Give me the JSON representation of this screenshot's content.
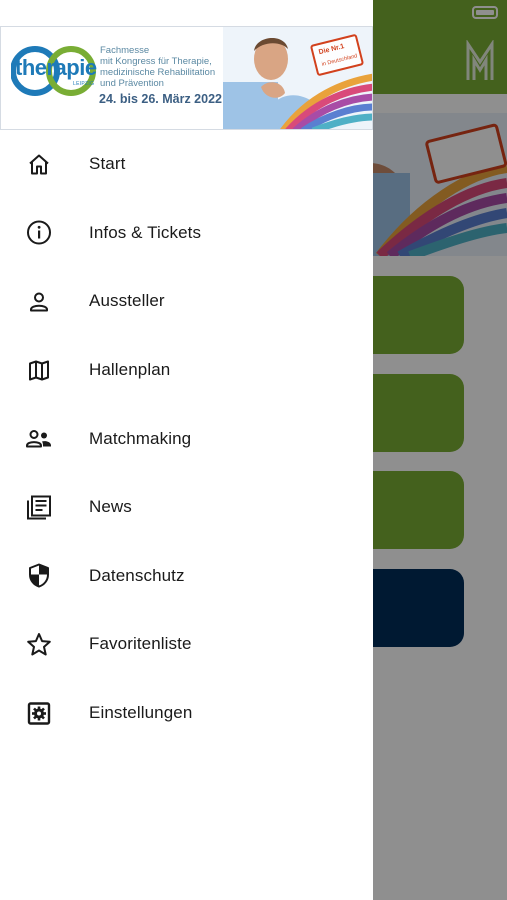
{
  "status_bar": {
    "battery_icon": "battery-full-icon"
  },
  "background_app": {
    "header_color": "#79ad35",
    "logo_icon": "messe-logo-icon",
    "tiles": [
      {
        "color": "#79ad35"
      },
      {
        "color": "#79ad35"
      },
      {
        "color": "#79ad35"
      },
      {
        "color": "#002d5a"
      }
    ]
  },
  "drawer": {
    "banner": {
      "brand": "therapie",
      "brand_sub": "LEIPZIG",
      "fair_lines": [
        "Fachmesse",
        "mit Kongress für Therapie,",
        "medizinische Rehabilitation",
        "und Prävention"
      ],
      "dates": "24. bis 26. März 2022",
      "badge_top": "Die Nr.1",
      "badge_sub": "in Deutschland"
    },
    "menu": [
      {
        "label": "Start",
        "icon": "home-icon"
      },
      {
        "label": "Infos & Tickets",
        "icon": "info-icon"
      },
      {
        "label": "Aussteller",
        "icon": "person-icon"
      },
      {
        "label": "Hallenplan",
        "icon": "map-icon"
      },
      {
        "label": "Matchmaking",
        "icon": "people-icon"
      },
      {
        "label": "News",
        "icon": "news-icon"
      },
      {
        "label": "Datenschutz",
        "icon": "shield-icon"
      },
      {
        "label": "Favoritenliste",
        "icon": "star-icon"
      },
      {
        "label": "Einstellungen",
        "icon": "settings-icon"
      }
    ]
  }
}
